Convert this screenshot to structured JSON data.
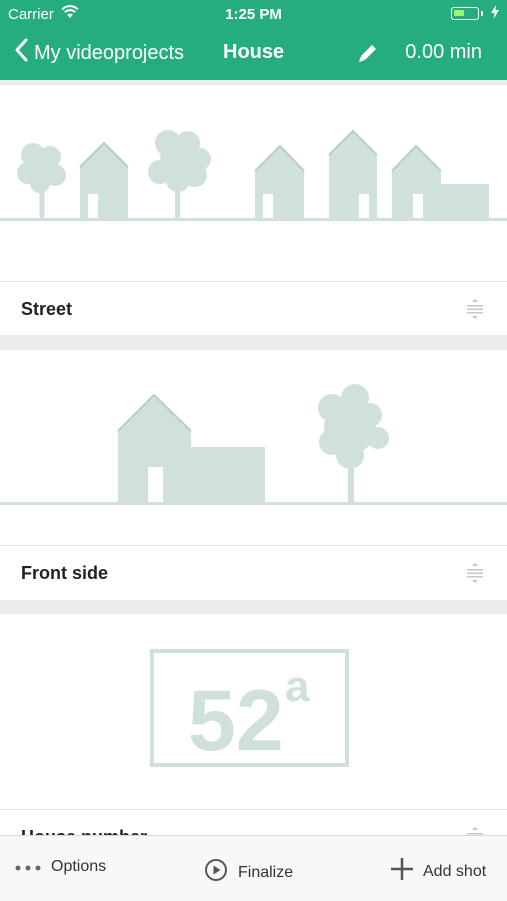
{
  "status_bar": {
    "carrier": "Carrier",
    "time": "1:25 PM"
  },
  "nav": {
    "back_label": "My videoprojects",
    "title": "House",
    "duration": "0.00 min"
  },
  "shots": [
    {
      "title": "Street",
      "illustration": "street-illustration"
    },
    {
      "title": "Front side",
      "illustration": "front-side-illustration"
    },
    {
      "title": "House number",
      "illustration": "house-number-illustration",
      "number": "52",
      "superscript": "a"
    }
  ],
  "toolbar": {
    "options": "Options",
    "finalize": "Finalize",
    "add_shot": "Add shot"
  },
  "colors": {
    "header": "#25ad7d",
    "illustration": "#cfe0dd",
    "separator": "#ececec"
  }
}
